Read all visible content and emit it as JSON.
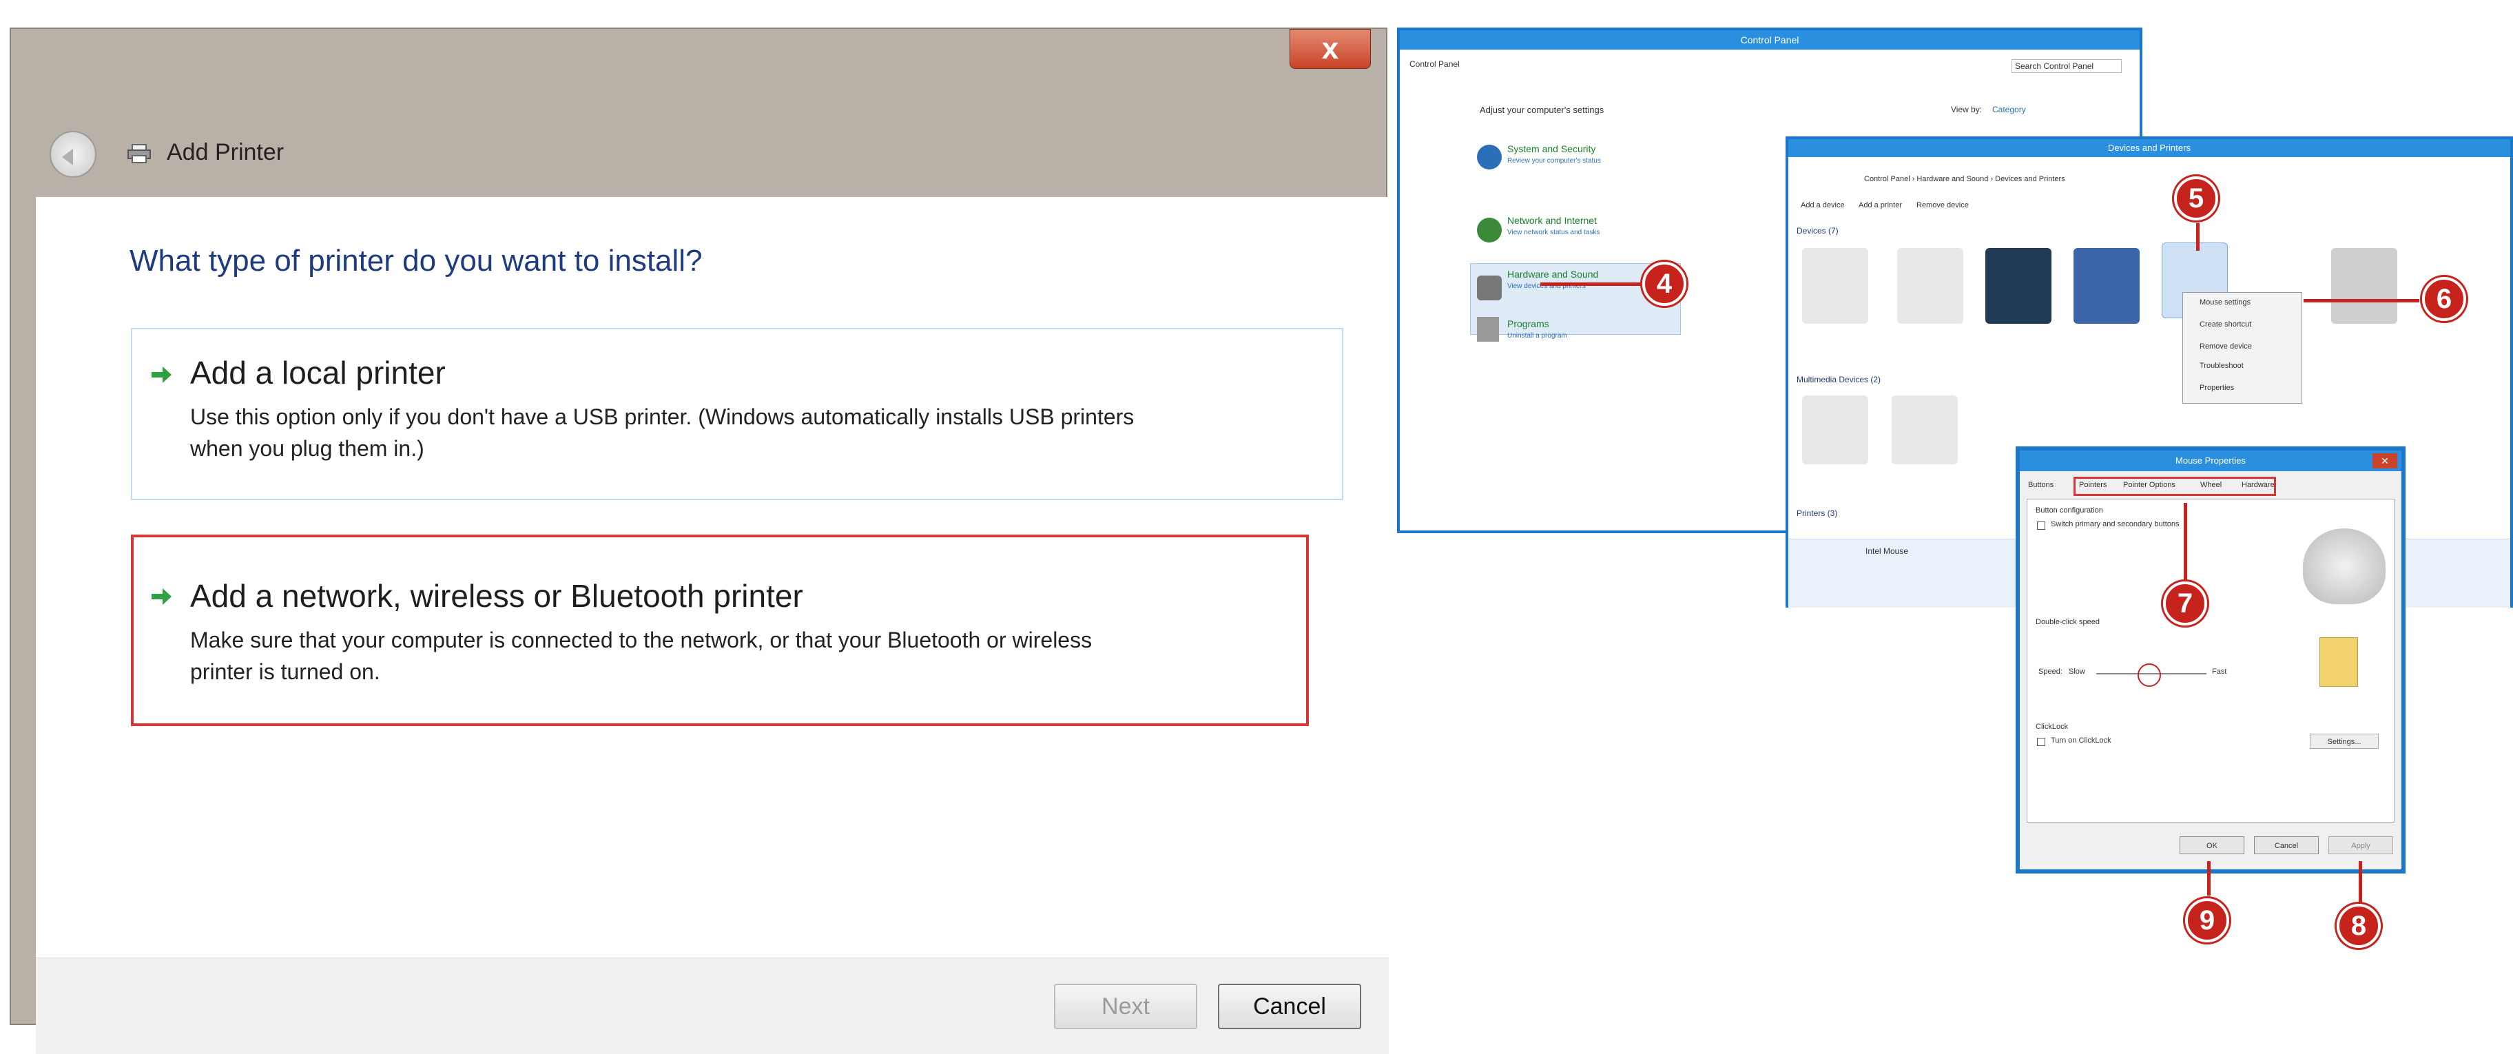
{
  "add_printer": {
    "title": "Add Printer",
    "close_glyph": "x",
    "question": "What type of printer do you want to install?",
    "options": [
      {
        "title": "Add a local printer",
        "description_line1": "Use this option only if you don't have a USB printer. (Windows automatically installs USB printers",
        "description_line2": "when you plug them in.)"
      },
      {
        "title": "Add a network, wireless or Bluetooth printer",
        "description_line1": "Make sure that your computer is connected to the network, or that your Bluetooth or wireless",
        "description_line2": "printer is turned on."
      }
    ],
    "buttons": {
      "next": "Next",
      "cancel": "Cancel"
    }
  },
  "control_panel": {
    "title": "Control Panel",
    "address": "Control Panel",
    "search_placeholder": "Search Control Panel",
    "heading": "Adjust your computer's settings",
    "view_by": "View by:",
    "view_by_value": "Category",
    "categories": [
      {
        "title": "System and Security",
        "sub": "Review your computer's status"
      },
      {
        "title": "Network and Internet",
        "sub": "View network status and tasks"
      },
      {
        "title": "Hardware and Sound",
        "sub": "View devices and printers"
      },
      {
        "title": "Programs",
        "sub": "Uninstall a program"
      }
    ]
  },
  "devices_printers": {
    "title": "Devices and Printers",
    "breadcrumb": "Control Panel › Hardware and Sound › Devices and Printers",
    "toolbar": [
      "Add a device",
      "Add a printer",
      "Remove device"
    ],
    "section_devices": "Devices (7)",
    "section_multimedia": "Multimedia Devices (2)",
    "section_printers": "Printers (3)",
    "context_menu": [
      "Mouse settings",
      "Create shortcut",
      "Remove device",
      "Troubleshoot",
      "Properties"
    ],
    "footer_device": "Intel Mouse"
  },
  "mouse_properties": {
    "title": "Mouse Properties",
    "tabs": [
      "Buttons",
      "Pointers",
      "Pointer Options",
      "Wheel",
      "Hardware"
    ],
    "button_config_label": "Button configuration",
    "switch_buttons": "Switch primary and secondary buttons",
    "double_click_label": "Double-click speed",
    "speed_label": "Speed:",
    "slow": "Slow",
    "fast": "Fast",
    "clicklock_label": "ClickLock",
    "clicklock_option": "Turn on ClickLock",
    "settings_btn": "Settings...",
    "ok": "OK",
    "cancel": "Cancel",
    "apply": "Apply"
  },
  "callouts": [
    "4",
    "5",
    "6",
    "7",
    "8",
    "9"
  ],
  "colors": {
    "accent": "#1d76c8",
    "callout": "#c7231d",
    "highlight_border": "#d6373a",
    "question": "#1e3b80"
  }
}
